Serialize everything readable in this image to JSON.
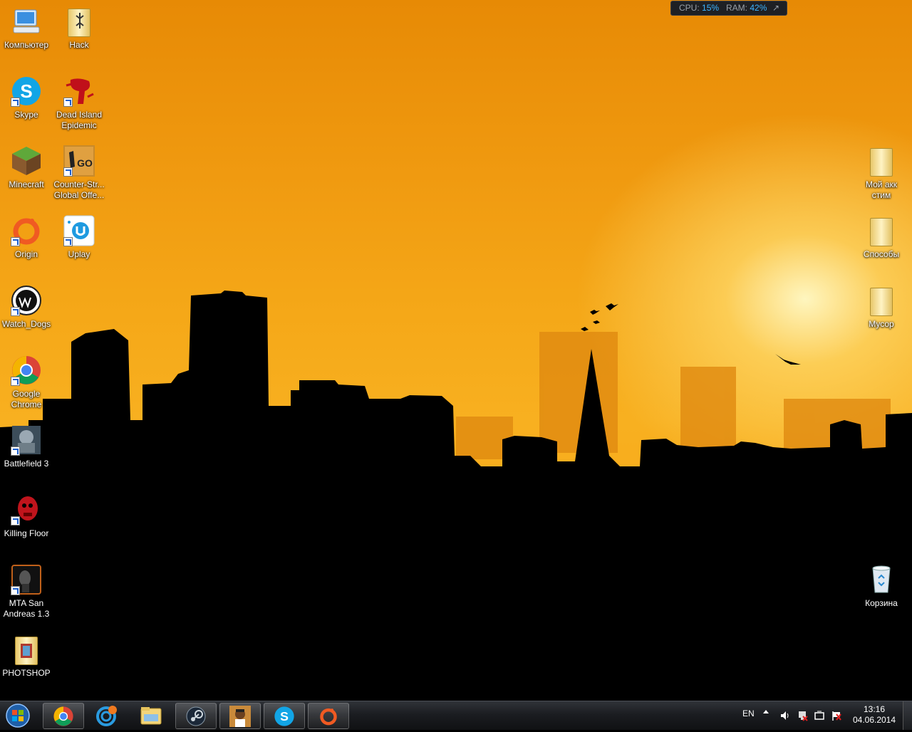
{
  "widget": {
    "cpu_label": "CPU:",
    "cpu_value": "15%",
    "ram_label": "RAM:",
    "ram_value": "42%",
    "icon": "external-arrow-icon"
  },
  "desktop": {
    "left_col1": [
      {
        "label": "Компьютер",
        "icon": "computer-icon"
      },
      {
        "label": "Skype",
        "icon": "skype-icon"
      },
      {
        "label": "Minecraft",
        "icon": "minecraft-icon"
      },
      {
        "label": "Origin",
        "icon": "origin-icon"
      },
      {
        "label": "Watch_Dogs",
        "icon": "watch-dogs-icon"
      },
      {
        "label": "Google\nChrome",
        "icon": "chrome-icon"
      },
      {
        "label": "Battlefield 3",
        "icon": "battlefield-icon"
      },
      {
        "label": "Killing Floor",
        "icon": "killing-floor-icon"
      },
      {
        "label": "MTA San\nAndreas 1.3",
        "icon": "mta-icon"
      },
      {
        "label": "PHOTSHOP",
        "icon": "folder-icon"
      }
    ],
    "left_col2": [
      {
        "label": "Hack",
        "icon": "folder-icon"
      },
      {
        "label": "Dead Island\nEpidemic",
        "icon": "dead-island-icon"
      },
      {
        "label": "Counter-Str...\nGlobal Offe...",
        "icon": "csgo-icon"
      },
      {
        "label": "Uplay",
        "icon": "uplay-icon"
      }
    ],
    "right_col": [
      {
        "label": "Мой акк\nстим",
        "icon": "folder-icon"
      },
      {
        "label": "Способы",
        "icon": "folder-icon"
      },
      {
        "label": "Мусор",
        "icon": "folder-icon"
      },
      {
        "label": "Корзина",
        "icon": "recycle-bin-icon"
      }
    ]
  },
  "taskbar": {
    "pinned": [
      "chrome-icon",
      "ccleaner-icon",
      "explorer-icon",
      "steam-icon",
      "gta-icon",
      "skype-icon",
      "origin-icon"
    ],
    "language": "EN",
    "time": "13:16",
    "date": "04.06.2014"
  }
}
